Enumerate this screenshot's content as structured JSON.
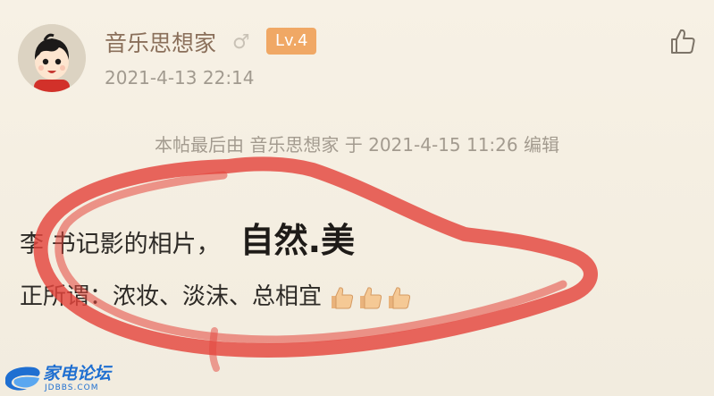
{
  "author": {
    "name": "音乐思想家",
    "gender_symbol": "♂",
    "level": "Lv.4",
    "post_time": "2021-4-13 22:14"
  },
  "edit_notice": "本帖最后由 音乐思想家 于 2021-4-15 11:26 编辑",
  "content": {
    "line1_text": "李 书记影的相片，",
    "line1_emphasis": "自然.美",
    "line2_text": "正所谓：浓妆、淡沫、总相宜"
  },
  "icons": {
    "like": "thumbs-up-outline-icon",
    "emoji": "thumbs-up-emoji-icon"
  },
  "watermark": {
    "text": "家电论坛",
    "sub": "JDBBS.COM"
  },
  "colors": {
    "background": "#f6f0e3",
    "username": "#8a6f5a",
    "level_badge": "#f0a865",
    "annotation_red": "#e4463d",
    "watermark_blue": "#1f6fd1"
  }
}
